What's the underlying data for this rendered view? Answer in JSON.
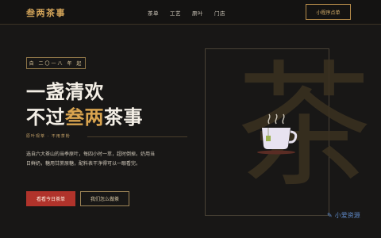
{
  "brand": {
    "name": "叁两茶事"
  },
  "nav": {
    "items": [
      "茶单",
      "工艺",
      "原叶",
      "门店"
    ]
  },
  "header": {
    "cta_label": "小程序点单"
  },
  "hero": {
    "badge": "自 二〇一八 年 起",
    "title_line1": "一盏清欢",
    "title_line2_prefix": "不过",
    "title_line2_accent": "叁两",
    "title_line2_suffix": "茶事",
    "tagline": "原叶现萃 · 不用茶粉",
    "description": "选自六大茶山的当季原叶，每四小时一萃，超时倒掉。奶用当日鲜奶，糖用甘蔗原糖，配料表干净得可以一眼看完。",
    "primary_button": "看看今日茶单",
    "secondary_button": "我们怎么做茶",
    "background_char": "茶"
  },
  "watermark": {
    "text": "小爱资源"
  },
  "colors": {
    "accent": "#d9a44f",
    "primary": "#b0332b",
    "bg": "#181716"
  }
}
